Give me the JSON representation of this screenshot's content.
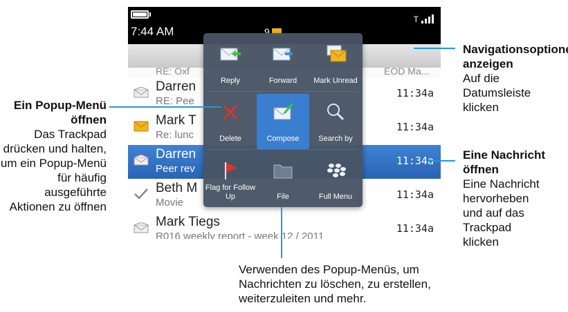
{
  "status_bar": {
    "time": "7:44 AM",
    "notification_count": "9",
    "signal_prefix": "T"
  },
  "partial_row": {
    "subject": "RE: Oxf",
    "time": "EOD Ma..."
  },
  "messages": [
    {
      "from": "Darren",
      "subject": "RE: Pee",
      "time": "11:34a",
      "icon": "opened-envelope-icon",
      "selected": false
    },
    {
      "from": "Mark T",
      "subject": "Re: lunc",
      "time": "11:34a",
      "icon": "unread-envelope-icon",
      "selected": false
    },
    {
      "from": "Darren",
      "subject": "Peer rev",
      "time": "11:34a",
      "icon": "opened-envelope-icon",
      "selected": true
    },
    {
      "from": "Beth M",
      "subject": "Movie",
      "time": "11:34a",
      "icon": "sent-check-icon",
      "selected": false
    },
    {
      "from": "Mark Tiegs",
      "subject": "R016 weekly report - week 12 / 2011",
      "time": "11:34a",
      "icon": "opened-envelope-icon",
      "selected": false
    }
  ],
  "popup_menu": [
    {
      "label": "Reply",
      "icon": "reply-icon"
    },
    {
      "label": "Forward",
      "icon": "forward-icon"
    },
    {
      "label": "Mark Unread",
      "icon": "mark-unread-icon"
    },
    {
      "label": "Delete",
      "icon": "delete-icon"
    },
    {
      "label": "Compose",
      "icon": "compose-icon",
      "active": true
    },
    {
      "label": "Search by",
      "icon": "search-icon"
    },
    {
      "label": "Flag for Follow Up",
      "icon": "flag-icon"
    },
    {
      "label": "File",
      "icon": "folder-icon"
    },
    {
      "label": "Full Menu",
      "icon": "blackberry-icon"
    }
  ],
  "annotations": {
    "popup": {
      "title": "Ein Popup-Menü öffnen",
      "body": "Das Trackpad drücken und halten, um ein Popup-Menü für häufig ausgeführte Aktionen zu öffnen"
    },
    "navigation": {
      "title": "Navigationsoptionen anzeigen",
      "body": "Auf die Datumsleiste klicken"
    },
    "open_message": {
      "title": "Eine Nachricht öffnen",
      "body": "Eine Nachricht hervorheben und auf das Trackpad klicken"
    },
    "bottom": "Verwenden des Popup-Menüs, um Nachrichten zu löschen, zu erstellen, weiterzuleiten und mehr."
  },
  "colors": {
    "accent_line": "#1e9bd7",
    "selection": "#2f6ec2",
    "envelope_yellow": "#f2b51f",
    "popup_bg": "#485464"
  }
}
